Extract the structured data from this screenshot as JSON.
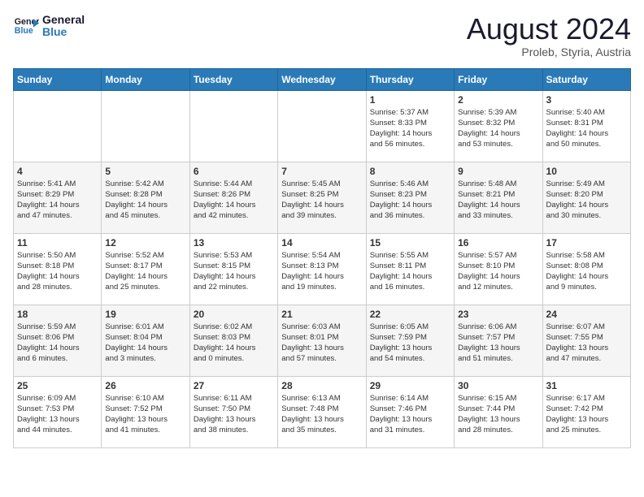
{
  "header": {
    "logo_line1": "General",
    "logo_line2": "Blue",
    "month_year": "August 2024",
    "location": "Proleb, Styria, Austria"
  },
  "weekdays": [
    "Sunday",
    "Monday",
    "Tuesday",
    "Wednesday",
    "Thursday",
    "Friday",
    "Saturday"
  ],
  "weeks": [
    [
      {
        "day": "",
        "info": ""
      },
      {
        "day": "",
        "info": ""
      },
      {
        "day": "",
        "info": ""
      },
      {
        "day": "",
        "info": ""
      },
      {
        "day": "1",
        "info": "Sunrise: 5:37 AM\nSunset: 8:33 PM\nDaylight: 14 hours\nand 56 minutes."
      },
      {
        "day": "2",
        "info": "Sunrise: 5:39 AM\nSunset: 8:32 PM\nDaylight: 14 hours\nand 53 minutes."
      },
      {
        "day": "3",
        "info": "Sunrise: 5:40 AM\nSunset: 8:31 PM\nDaylight: 14 hours\nand 50 minutes."
      }
    ],
    [
      {
        "day": "4",
        "info": "Sunrise: 5:41 AM\nSunset: 8:29 PM\nDaylight: 14 hours\nand 47 minutes."
      },
      {
        "day": "5",
        "info": "Sunrise: 5:42 AM\nSunset: 8:28 PM\nDaylight: 14 hours\nand 45 minutes."
      },
      {
        "day": "6",
        "info": "Sunrise: 5:44 AM\nSunset: 8:26 PM\nDaylight: 14 hours\nand 42 minutes."
      },
      {
        "day": "7",
        "info": "Sunrise: 5:45 AM\nSunset: 8:25 PM\nDaylight: 14 hours\nand 39 minutes."
      },
      {
        "day": "8",
        "info": "Sunrise: 5:46 AM\nSunset: 8:23 PM\nDaylight: 14 hours\nand 36 minutes."
      },
      {
        "day": "9",
        "info": "Sunrise: 5:48 AM\nSunset: 8:21 PM\nDaylight: 14 hours\nand 33 minutes."
      },
      {
        "day": "10",
        "info": "Sunrise: 5:49 AM\nSunset: 8:20 PM\nDaylight: 14 hours\nand 30 minutes."
      }
    ],
    [
      {
        "day": "11",
        "info": "Sunrise: 5:50 AM\nSunset: 8:18 PM\nDaylight: 14 hours\nand 28 minutes."
      },
      {
        "day": "12",
        "info": "Sunrise: 5:52 AM\nSunset: 8:17 PM\nDaylight: 14 hours\nand 25 minutes."
      },
      {
        "day": "13",
        "info": "Sunrise: 5:53 AM\nSunset: 8:15 PM\nDaylight: 14 hours\nand 22 minutes."
      },
      {
        "day": "14",
        "info": "Sunrise: 5:54 AM\nSunset: 8:13 PM\nDaylight: 14 hours\nand 19 minutes."
      },
      {
        "day": "15",
        "info": "Sunrise: 5:55 AM\nSunset: 8:11 PM\nDaylight: 14 hours\nand 16 minutes."
      },
      {
        "day": "16",
        "info": "Sunrise: 5:57 AM\nSunset: 8:10 PM\nDaylight: 14 hours\nand 12 minutes."
      },
      {
        "day": "17",
        "info": "Sunrise: 5:58 AM\nSunset: 8:08 PM\nDaylight: 14 hours\nand 9 minutes."
      }
    ],
    [
      {
        "day": "18",
        "info": "Sunrise: 5:59 AM\nSunset: 8:06 PM\nDaylight: 14 hours\nand 6 minutes."
      },
      {
        "day": "19",
        "info": "Sunrise: 6:01 AM\nSunset: 8:04 PM\nDaylight: 14 hours\nand 3 minutes."
      },
      {
        "day": "20",
        "info": "Sunrise: 6:02 AM\nSunset: 8:03 PM\nDaylight: 14 hours\nand 0 minutes."
      },
      {
        "day": "21",
        "info": "Sunrise: 6:03 AM\nSunset: 8:01 PM\nDaylight: 13 hours\nand 57 minutes."
      },
      {
        "day": "22",
        "info": "Sunrise: 6:05 AM\nSunset: 7:59 PM\nDaylight: 13 hours\nand 54 minutes."
      },
      {
        "day": "23",
        "info": "Sunrise: 6:06 AM\nSunset: 7:57 PM\nDaylight: 13 hours\nand 51 minutes."
      },
      {
        "day": "24",
        "info": "Sunrise: 6:07 AM\nSunset: 7:55 PM\nDaylight: 13 hours\nand 47 minutes."
      }
    ],
    [
      {
        "day": "25",
        "info": "Sunrise: 6:09 AM\nSunset: 7:53 PM\nDaylight: 13 hours\nand 44 minutes."
      },
      {
        "day": "26",
        "info": "Sunrise: 6:10 AM\nSunset: 7:52 PM\nDaylight: 13 hours\nand 41 minutes."
      },
      {
        "day": "27",
        "info": "Sunrise: 6:11 AM\nSunset: 7:50 PM\nDaylight: 13 hours\nand 38 minutes."
      },
      {
        "day": "28",
        "info": "Sunrise: 6:13 AM\nSunset: 7:48 PM\nDaylight: 13 hours\nand 35 minutes."
      },
      {
        "day": "29",
        "info": "Sunrise: 6:14 AM\nSunset: 7:46 PM\nDaylight: 13 hours\nand 31 minutes."
      },
      {
        "day": "30",
        "info": "Sunrise: 6:15 AM\nSunset: 7:44 PM\nDaylight: 13 hours\nand 28 minutes."
      },
      {
        "day": "31",
        "info": "Sunrise: 6:17 AM\nSunset: 7:42 PM\nDaylight: 13 hours\nand 25 minutes."
      }
    ]
  ]
}
